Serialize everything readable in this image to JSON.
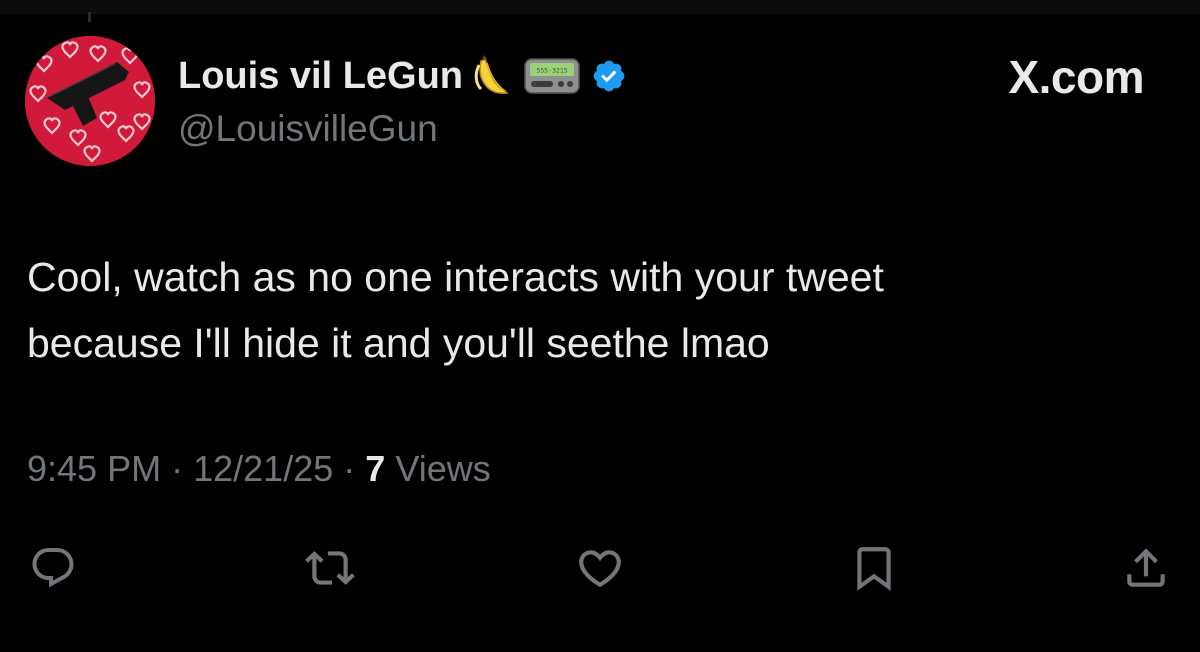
{
  "author": {
    "display_name": "Louis vil LeGun",
    "handle": "@LouisvilleGun",
    "emojis": [
      "banana-emoji",
      "pager-emoji"
    ],
    "pager_text": "555-3215",
    "verified": true,
    "verified_color": "#1d9bf0"
  },
  "watermark": "X.com",
  "tweet": {
    "lines": [
      "Cool, watch as no one interacts with your tweet",
      "because I'll hide it and you'll seethe lmao"
    ]
  },
  "meta": {
    "time": "9:45 PM",
    "separator": "·",
    "date": "12/21/25",
    "views_count": "7",
    "views_label": "Views"
  },
  "actions": [
    {
      "name": "reply-icon"
    },
    {
      "name": "retweet-icon"
    },
    {
      "name": "like-icon"
    },
    {
      "name": "bookmark-icon"
    },
    {
      "name": "share-icon"
    }
  ],
  "colors": {
    "background": "#000000",
    "text": "#e7e9ea",
    "secondary": "#71767b",
    "avatar_bg": "#d11a3a"
  }
}
